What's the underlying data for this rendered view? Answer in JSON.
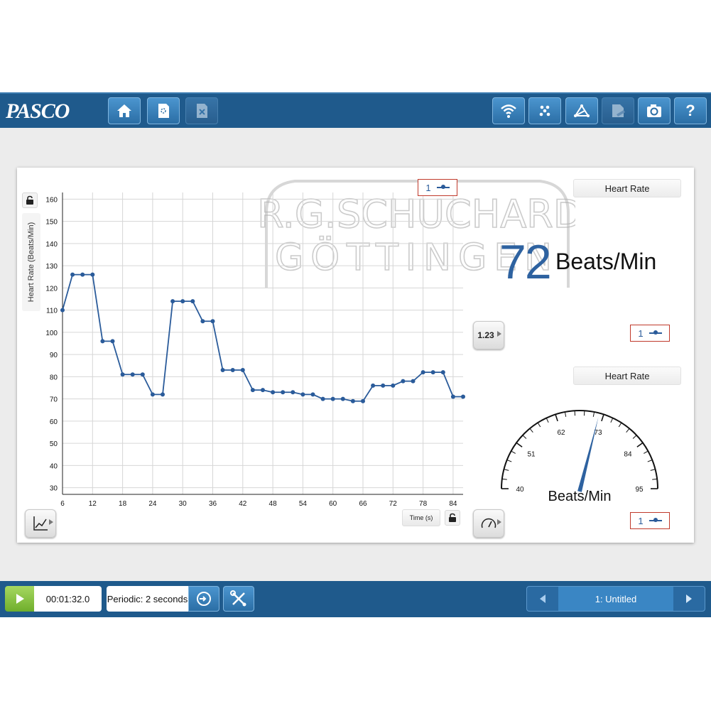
{
  "app": {
    "logo_text": "PASCO",
    "colors": {
      "toolbar": "#1f5a8c",
      "series": "#2a5b9a",
      "play": "#7ab83a",
      "legend_border": "#c0392b"
    }
  },
  "toolbar": {
    "left_buttons": [
      "home-icon",
      "new-experiment-icon",
      "close-experiment-icon"
    ],
    "right_buttons": [
      "wireless-sensors-icon",
      "data-summary-icon",
      "calculator-icon",
      "journal-icon",
      "snapshot-icon",
      "help-icon"
    ],
    "help_label": "?"
  },
  "graph": {
    "y_axis_label": "Heart Rate (Beats/Min)",
    "x_axis_label": "Time (s)",
    "legend_run": "1",
    "chart_data": {
      "type": "line",
      "title": "",
      "xlabel": "Time (s)",
      "ylabel": "Heart Rate (Beats/Min)",
      "xlim": [
        6,
        86
      ],
      "ylim": [
        27,
        163
      ],
      "x_ticks": [
        6,
        12,
        18,
        24,
        30,
        36,
        42,
        48,
        54,
        60,
        66,
        72,
        78,
        84
      ],
      "y_ticks": [
        30,
        40,
        50,
        60,
        70,
        80,
        90,
        100,
        110,
        120,
        130,
        140,
        150,
        160
      ],
      "grid": true,
      "series": [
        {
          "name": "1",
          "x": [
            6,
            8,
            10,
            12,
            14,
            16,
            18,
            20,
            22,
            24,
            26,
            28,
            30,
            32,
            34,
            36,
            38,
            40,
            42,
            44,
            46,
            48,
            50,
            52,
            54,
            56,
            58,
            60,
            62,
            64,
            66,
            68,
            70,
            72,
            74,
            76,
            78,
            80,
            82,
            84,
            86
          ],
          "y": [
            110,
            126,
            126,
            126,
            96,
            96,
            81,
            81,
            81,
            72,
            72,
            114,
            114,
            114,
            105,
            105,
            83,
            83,
            83,
            74,
            74,
            73,
            73,
            73,
            72,
            72,
            70,
            70,
            70,
            69,
            69,
            76,
            76,
            76,
            78,
            78,
            82,
            82,
            82,
            71,
            71
          ]
        }
      ]
    }
  },
  "digits": {
    "title": "Heart Rate",
    "value": "72",
    "unit": "Beats/Min",
    "legend_run": "1",
    "button_label": "1.23"
  },
  "meter": {
    "title": "Heart Rate",
    "unit": "Beats/Min",
    "value": 72,
    "min": 40,
    "max": 95,
    "tick_labels": [
      "40",
      "51",
      "62",
      "73",
      "84",
      "95"
    ],
    "legend_run": "1"
  },
  "bottom": {
    "timer": "00:01:32.0",
    "sampling": "Periodic: 2 seconds",
    "page_title": "1: Untitled"
  },
  "watermark": {
    "line1": "DR.G.SCHUCHARDT",
    "line2": "GÖTTINGEN"
  }
}
